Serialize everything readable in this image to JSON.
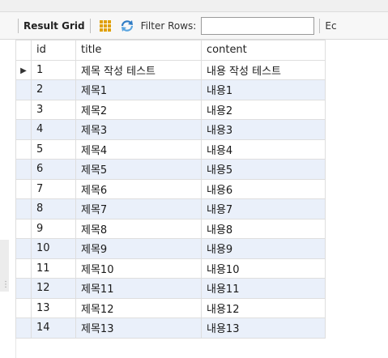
{
  "toolbar": {
    "result_grid_label": "Result Grid",
    "filter_rows_label": "Filter Rows:",
    "filter_value": "",
    "edit_label_partial": "Ec"
  },
  "grid": {
    "columns": [
      "id",
      "title",
      "content"
    ],
    "current_row_marker": "▶",
    "rows": [
      [
        "1",
        "제목 작성 테스트",
        "내용 작성 테스트"
      ],
      [
        "2",
        "제목1",
        "내용1"
      ],
      [
        "3",
        "제목2",
        "내용2"
      ],
      [
        "4",
        "제목3",
        "내용3"
      ],
      [
        "5",
        "제목4",
        "내용4"
      ],
      [
        "6",
        "제목5",
        "내용5"
      ],
      [
        "7",
        "제목6",
        "내용6"
      ],
      [
        "8",
        "제목7",
        "내용7"
      ],
      [
        "9",
        "제목8",
        "내용8"
      ],
      [
        "10",
        "제목9",
        "내용9"
      ],
      [
        "11",
        "제목10",
        "내용10"
      ],
      [
        "12",
        "제목11",
        "내용11"
      ],
      [
        "13",
        "제목12",
        "내용12"
      ],
      [
        "14",
        "제목13",
        "내용13"
      ]
    ]
  }
}
